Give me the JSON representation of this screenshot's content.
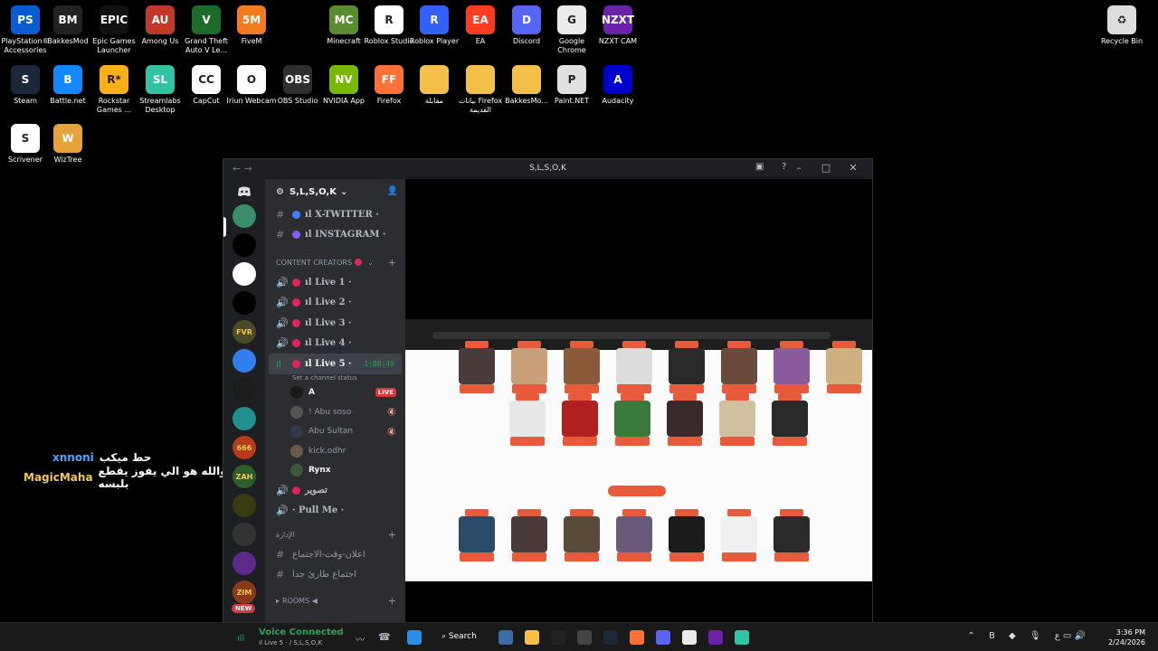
{
  "desktop_icons": [
    {
      "label": "PlayStation® Accessories",
      "color": "#0b5bd3",
      "glyph": "PS"
    },
    {
      "label": "BakkesMod",
      "color": "#222222",
      "glyph": "BM"
    },
    {
      "label": "Epic Games Launcher",
      "color": "#111111",
      "glyph": "EPIC"
    },
    {
      "label": "Among Us",
      "color": "#c0392b",
      "glyph": "AU"
    },
    {
      "label": "Grand Theft Auto V Le...",
      "color": "#1d6b2b",
      "glyph": "V"
    },
    {
      "label": "FiveM",
      "color": "#f47b20",
      "glyph": "5M"
    },
    {
      "label": "Minecraft",
      "color": "#5b8c32",
      "glyph": "MC"
    },
    {
      "label": "Roblox Studio",
      "color": "#ffffff",
      "glyph": "R"
    },
    {
      "label": "Roblox Player",
      "color": "#335fff",
      "glyph": "R"
    },
    {
      "label": "EA",
      "color": "#ff3c1f",
      "glyph": "EA"
    },
    {
      "label": "Discord",
      "color": "#5865f2",
      "glyph": "D"
    },
    {
      "label": "Google Chrome",
      "color": "#eaeaea",
      "glyph": "G"
    },
    {
      "label": "NZXT CAM",
      "color": "#6b21a8",
      "glyph": "NZXT"
    },
    {
      "label": "Recycle Bin",
      "color": "#dddddd",
      "glyph": "♻"
    },
    {
      "label": "Steam",
      "color": "#1b2838",
      "glyph": "S"
    },
    {
      "label": "Battle.net",
      "color": "#1489ff",
      "glyph": "B"
    },
    {
      "label": "Rockstar Games ...",
      "color": "#fcaf17",
      "glyph": "R*"
    },
    {
      "label": "Streamlabs Desktop",
      "color": "#31c3a2",
      "glyph": "SL"
    },
    {
      "label": "CapCut",
      "color": "#ffffff",
      "glyph": "CC"
    },
    {
      "label": "Iriun Webcam",
      "color": "#ffffff",
      "glyph": "O"
    },
    {
      "label": "OBS Studio",
      "color": "#302e31",
      "glyph": "OBS"
    },
    {
      "label": "NVIDIA App",
      "color": "#76b900",
      "glyph": "NV"
    },
    {
      "label": "Firefox",
      "color": "#ff7139",
      "glyph": "FF"
    },
    {
      "label": "مقابلة",
      "color": "#f3c04a",
      "glyph": ""
    },
    {
      "label": "بيانات Firefox القديمة",
      "color": "#f3c04a",
      "glyph": ""
    },
    {
      "label": "BakkesMo...",
      "color": "#f3c04a",
      "glyph": ""
    },
    {
      "label": "Paint.NET",
      "color": "#e0e0e0",
      "glyph": "P"
    },
    {
      "label": "Audacity",
      "color": "#0000cc",
      "glyph": "A"
    },
    {
      "label": "Scrivener",
      "color": "#ffffff",
      "glyph": "S"
    },
    {
      "label": "WizTree",
      "color": "#e8a23a",
      "glyph": "W"
    }
  ],
  "chat": [
    {
      "user": "xnnoni",
      "message": "حط ميكب",
      "color": "#4aa8ff"
    },
    {
      "user": "MagicMaha",
      "message": "والله هو الي يفوز يقطع بلبسه",
      "color": "#f2c94c"
    }
  ],
  "window": {
    "title": "S,L,S,O,K",
    "server_name": "S,L,S,O,K",
    "back": "←",
    "forward": "→",
    "minimize": "–",
    "maximize": "□",
    "close": "✕"
  },
  "guild_colors": [
    "#3a8f6a",
    "#000000",
    "#ffffff",
    "#000000",
    "#4b4b2a",
    "#2f80ed",
    "#1c1c1c",
    "#1f8f8f",
    "#b83a1a",
    "#2d5c2d",
    "#3a3a10",
    "#333333",
    "#5b2a8a",
    "#8a3a1a"
  ],
  "guild_labels": [
    "",
    "",
    "",
    "",
    "FVR",
    "",
    "",
    "",
    "666",
    "ZAH",
    "",
    "",
    "",
    "ZIM"
  ],
  "new_badge": "NEW",
  "channels": {
    "top": [
      {
        "name": "ıl X-TWITTER ·",
        "dot": "#3b82f6"
      },
      {
        "name": "ıl INSTAGRAM ·",
        "dot": "#8b5cf6"
      }
    ],
    "category_creators": "CONTENT CREATORS",
    "live_channels": [
      "ıl Live 1 ·",
      "ıl Live 2 ·",
      "ıl Live 3 ·",
      "ıl Live 4 ·"
    ],
    "active_channel": "ıl Live 5 ·",
    "active_time": "1:08:49",
    "channel_status": "Set a channel status",
    "voice_users": [
      {
        "name": "A",
        "badge": "LIVE",
        "avatar": "#1a1a1a"
      },
      {
        "name": "! Abu soso",
        "badge": "",
        "avatar": "#555555"
      },
      {
        "name": "Abu Sultan",
        "badge": "",
        "avatar": "#2f3a4a"
      },
      {
        "name": "kick.odhr",
        "badge": "",
        "avatar": "#6b5a4a"
      },
      {
        "name": "Rynx",
        "badge": "",
        "avatar": "#3a5a3a"
      }
    ],
    "after": [
      {
        "name": "تصوير",
        "sym": "🔊"
      },
      {
        "name": "· Pull Me ·",
        "sym": "🔊"
      }
    ],
    "category_admin": "الإدارة ⁩",
    "admin_channels": [
      "اعلان-وقت-الاجتماع",
      "اجتماع طارئ جدا"
    ],
    "category_rooms": "ROOMS ◀"
  },
  "voice": {
    "connected": "Voice Connected",
    "channel": "ıl Live 5 · / S,L,S,O,K"
  },
  "taskbar": {
    "search": "Search",
    "time": "3:36 PM",
    "date": "2/24/2026",
    "lang": "ع"
  },
  "stream_cards_top_colors": [
    "#4a3a3a",
    "#c8a07a",
    "#8a5a3a",
    "#dcdcdc",
    "#2a2a2a",
    "#6a4a3a",
    "#8a5a9a",
    "#d0b080"
  ],
  "stream_cards_mid_colors": [
    "#e8e8e8",
    "#b02020",
    "#3a7a3a",
    "#3a2a2a",
    "#d0c0a0",
    "#2a2a2a"
  ],
  "stream_cards_bot_colors": [
    "#2a4a6a",
    "#4a3a3a",
    "#5a4a3a",
    "#6a5a7a",
    "#1a1a1a",
    "#f0f0f0",
    "#2a2a2a"
  ]
}
